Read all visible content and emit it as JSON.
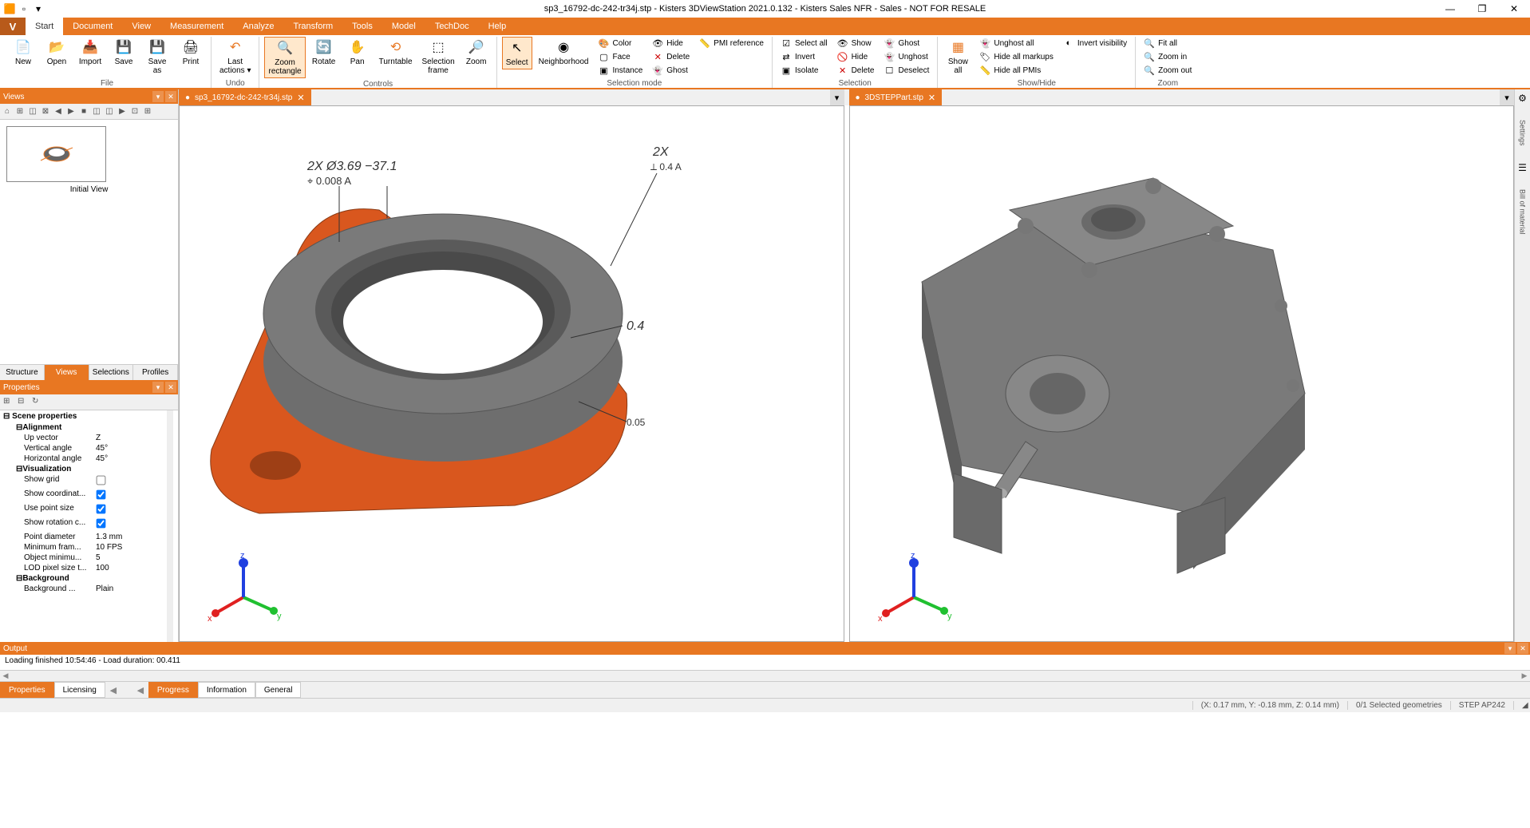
{
  "titlebar": {
    "title": "sp3_16792-dc-242-tr34j.stp - Kisters 3DViewStation 2021.0.132 - Kisters Sales NFR - Sales - NOT FOR RESALE",
    "minimize": "—",
    "restore": "❐",
    "close": "✕"
  },
  "tabs": {
    "app": "V",
    "items": [
      "Start",
      "Document",
      "View",
      "Measurement",
      "Analyze",
      "Transform",
      "Tools",
      "Model",
      "TechDoc",
      "Help"
    ],
    "active": 0
  },
  "ribbon": {
    "file": {
      "label": "File",
      "new": "New",
      "open": "Open",
      "import": "Import",
      "save": "Save",
      "saveas": "Save\nas",
      "print": "Print"
    },
    "undo": {
      "label": "Undo",
      "last": "Last\nactions ▾"
    },
    "controls": {
      "label": "Controls",
      "zoomrect": "Zoom\nrectangle",
      "rotate": "Rotate",
      "pan": "Pan",
      "turntable": "Turntable",
      "selframe": "Selection\nframe",
      "zoom": "Zoom"
    },
    "selmode": {
      "label": "Selection mode",
      "select": "Select",
      "neighborhood": "Neighborhood",
      "col1": [
        "Color",
        "Face",
        "Instance"
      ],
      "col2": [
        "Hide",
        "Delete",
        "Ghost"
      ],
      "pmi": "PMI reference"
    },
    "selection": {
      "label": "Selection",
      "col1": [
        "Select all",
        "Invert",
        "Isolate"
      ],
      "col2": [
        "Show",
        "Hide",
        "Delete"
      ],
      "col3": [
        "Ghost",
        "Unghost",
        "Deselect"
      ]
    },
    "showhide": {
      "label": "Show/Hide",
      "showall": "Show\nall",
      "col1": [
        "Unghost all",
        "Hide all markups",
        "Hide all PMIs"
      ],
      "inv": "Invert visibility"
    },
    "zoom": {
      "label": "Zoom",
      "col1": [
        "Fit all",
        "Zoom in",
        "Zoom out"
      ]
    }
  },
  "views_panel": {
    "title": "Views",
    "initial_view": "Initial View",
    "tabs": [
      "Structure",
      "Views",
      "Selections",
      "Profiles"
    ],
    "tabs_active": 1
  },
  "props_panel": {
    "title": "Properties",
    "section": "Scene properties",
    "alignment": "Alignment",
    "visualization": "Visualization",
    "background": "Background",
    "rows": {
      "up_vector": {
        "k": "Up vector",
        "v": "Z"
      },
      "vert_ang": {
        "k": "Vertical angle",
        "v": "45°"
      },
      "horiz_ang": {
        "k": "Horizontal angle",
        "v": "45°"
      },
      "show_grid": {
        "k": "Show grid",
        "v": false
      },
      "show_coord": {
        "k": "Show coordinat...",
        "v": true
      },
      "use_point": {
        "k": "Use point size",
        "v": true
      },
      "show_rot": {
        "k": "Show rotation c...",
        "v": true
      },
      "point_diam": {
        "k": "Point diameter",
        "v": "1.3 mm"
      },
      "min_fram": {
        "k": "Minimum fram...",
        "v": "10 FPS"
      },
      "obj_min": {
        "k": "Object minimu...",
        "v": "5"
      },
      "lod": {
        "k": "LOD pixel size t...",
        "v": "100"
      },
      "bg": {
        "k": "Background ...",
        "v": "Plain"
      }
    },
    "bottom_tabs": [
      "Properties",
      "Licensing"
    ],
    "bottom_active": 0
  },
  "docs": {
    "tab1": "sp3_16792-dc-242-tr34j.stp",
    "tab2": "3DSTEPPart.stp"
  },
  "viewport1": {
    "annot1": "2X Ø3.69  −37.1",
    "annot2": "⌖ 0.008 A",
    "annot3": "2X",
    "annot4": "⟂ 0.4 A",
    "annot5": "0.4",
    "annot6": "0.05"
  },
  "right_rail": {
    "settings": "Settings",
    "bom": "Bill of material"
  },
  "output": {
    "title": "Output",
    "msg": "Loading finished 10:54:46 - Load duration: 00.411",
    "tabs": [
      "Progress",
      "Information",
      "General"
    ],
    "tabs_active": 0
  },
  "status": {
    "coords": "(X: 0.17 mm, Y: -0.18 mm, Z: 0.14 mm)",
    "sel": "0/1 Selected geometries",
    "fmt": "STEP AP242"
  }
}
